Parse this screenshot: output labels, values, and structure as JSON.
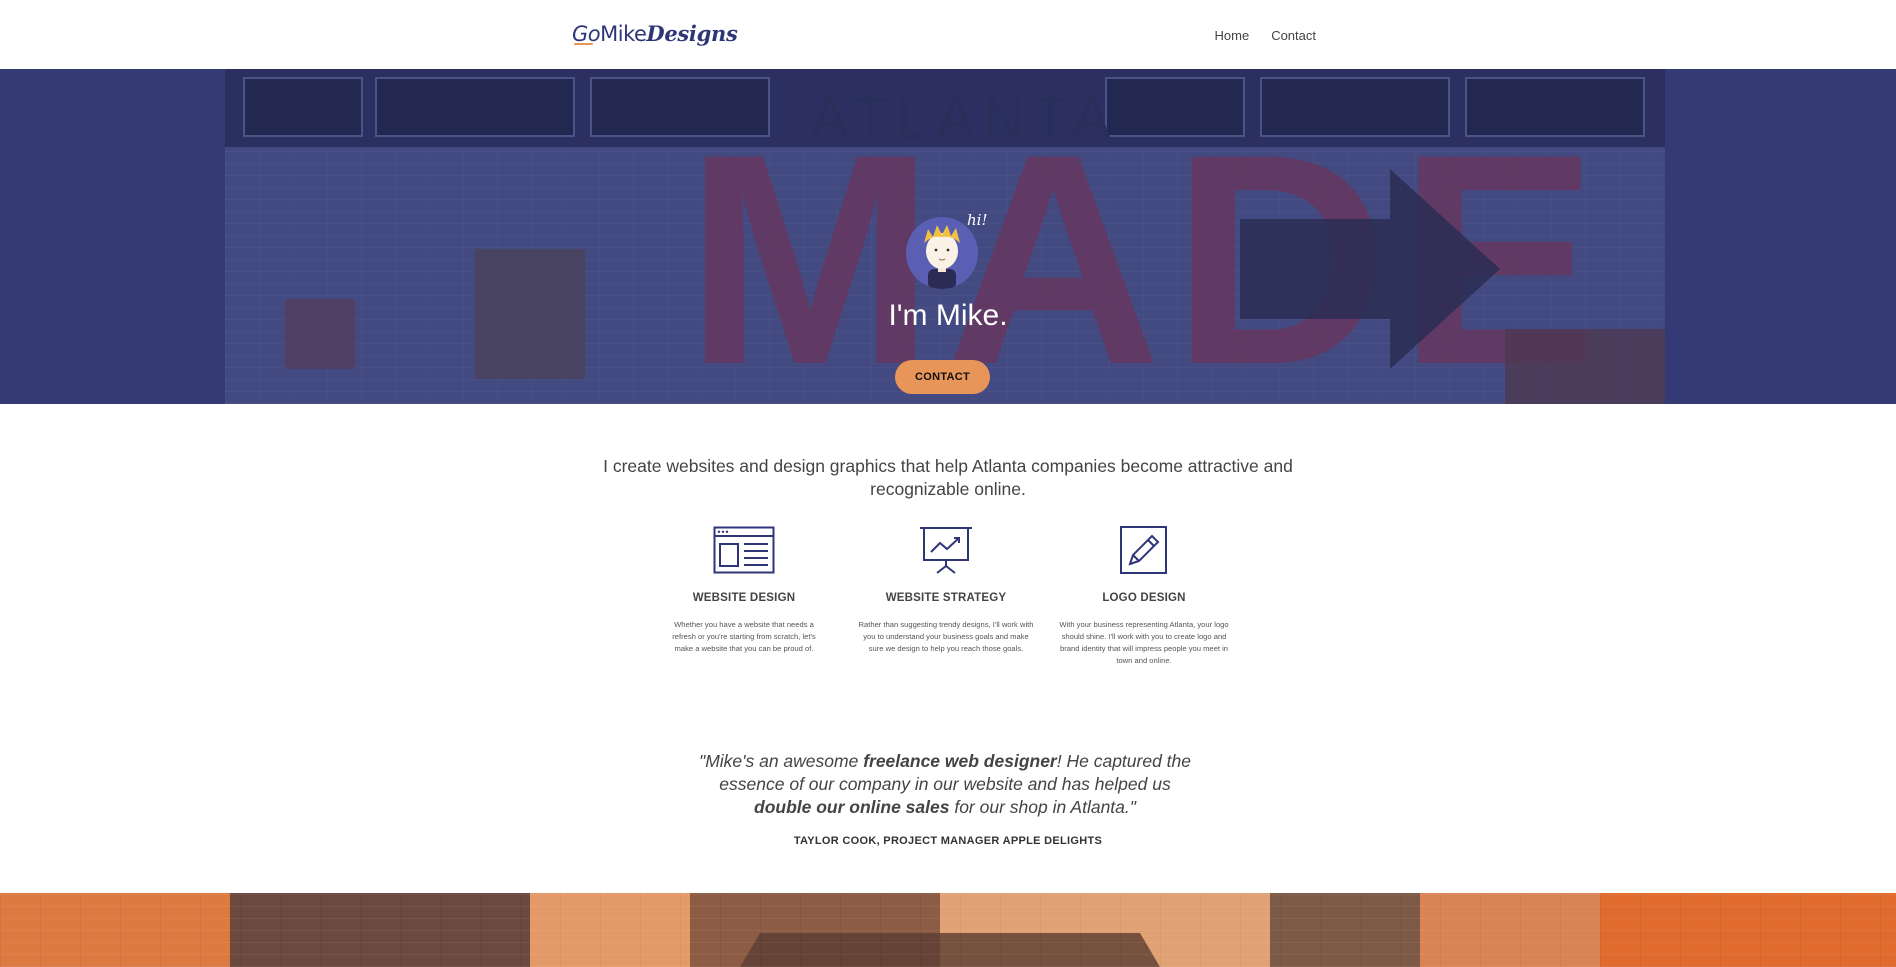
{
  "header": {
    "logo": {
      "go": "Go",
      "mike": "Mike",
      "designs": "Designs"
    },
    "nav": [
      {
        "label": "Home"
      },
      {
        "label": "Contact"
      }
    ]
  },
  "hero": {
    "wall_text_top": "ATLANTA",
    "wall_text_main": "MADE",
    "greeting_bubble": "hi!",
    "title": "I'm Mike.",
    "cta_label": "CONTACT"
  },
  "intro": {
    "text": "I create websites and design graphics that help Atlanta companies become attractive and recognizable online."
  },
  "services": [
    {
      "icon": "browser-window-icon",
      "title": "WEBSITE DESIGN",
      "description": "Whether you have a website that needs a refresh or you're starting from scratch, let's make a website that you can be proud of."
    },
    {
      "icon": "presentation-chart-icon",
      "title": "WEBSITE STRATEGY",
      "description": "Rather than suggesting trendy designs, I'll work with you to understand your business goals and make sure we design to help you reach those goals."
    },
    {
      "icon": "pencil-icon",
      "title": "LOGO DESIGN",
      "description": "With your business representing Atlanta, your logo should shine. I'll work with you to create logo and brand identity that will impress people you meet in town and online."
    }
  ],
  "testimonial": {
    "part1": "\"Mike's an awesome ",
    "bold1": "freelance web designer",
    "part2": "! He captured the essence of our company in our website and has helped us ",
    "bold2": "double our online sales",
    "part3": " for our shop in Atlanta.\"",
    "author": "TAYLOR COOK, PROJECT MANAGER APPLE DELIGHTS"
  },
  "colors": {
    "brand_navy": "#2e3678",
    "hero_overlay": "#353a74",
    "accent_orange": "#e8955a",
    "banner_orange": "#cf6f3a"
  }
}
